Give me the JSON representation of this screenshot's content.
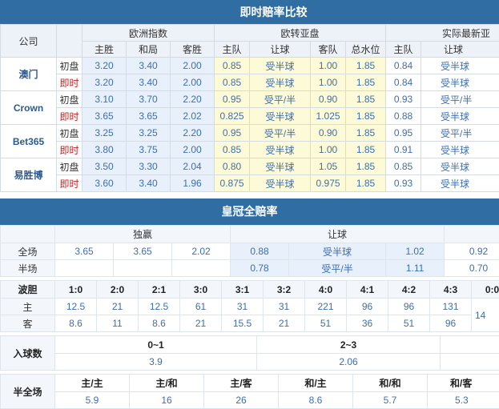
{
  "section1": {
    "title": "即时赔率比较",
    "company_header": "公司",
    "groups": [
      "欧洲指数",
      "欧转亚盘",
      "实际最新亚"
    ],
    "cols": [
      "主胜",
      "和局",
      "客胜",
      "主队",
      "让球",
      "客队",
      "总水位",
      "主队",
      "让球"
    ],
    "companies": [
      {
        "name": "澳门",
        "init": {
          "label": "初盘",
          "v": [
            "3.20",
            "3.40",
            "2.00",
            "0.85",
            "受半球",
            "1.00",
            "1.85",
            "0.84",
            "受半球"
          ]
        },
        "live": {
          "label": "即时",
          "v": [
            "3.20",
            "3.40",
            "2.00",
            "0.85",
            "受半球",
            "1.00",
            "1.85",
            "0.84",
            "受半球"
          ]
        }
      },
      {
        "name": "Crown",
        "init": {
          "label": "初盘",
          "v": [
            "3.10",
            "3.70",
            "2.20",
            "0.95",
            "受平/半",
            "0.90",
            "1.85",
            "0.93",
            "受平/半"
          ]
        },
        "live": {
          "label": "即时",
          "v": [
            "3.65",
            "3.65",
            "2.02",
            "0.825",
            "受半球",
            "1.025",
            "1.85",
            "0.88",
            "受半球"
          ]
        }
      },
      {
        "name": "Bet365",
        "init": {
          "label": "初盘",
          "v": [
            "3.25",
            "3.25",
            "2.20",
            "0.95",
            "受平/半",
            "0.90",
            "1.85",
            "0.95",
            "受平/半"
          ]
        },
        "live": {
          "label": "即时",
          "v": [
            "3.80",
            "3.75",
            "2.00",
            "0.85",
            "受半球",
            "1.00",
            "1.85",
            "0.91",
            "受半球"
          ]
        }
      },
      {
        "name": "易胜博",
        "init": {
          "label": "初盘",
          "v": [
            "3.50",
            "3.30",
            "2.04",
            "0.80",
            "受半球",
            "1.05",
            "1.85",
            "0.85",
            "受半球"
          ]
        },
        "live": {
          "label": "即时",
          "v": [
            "3.60",
            "3.40",
            "1.96",
            "0.875",
            "受半球",
            "0.975",
            "1.85",
            "0.93",
            "受半球"
          ]
        }
      }
    ]
  },
  "section2": {
    "title": "皇冠全赔率",
    "groups": [
      "独赢",
      "让球"
    ],
    "full": {
      "label": "全场",
      "v": [
        "3.65",
        "3.65",
        "2.02",
        "0.88",
        "受半球",
        "1.02",
        "0.92"
      ]
    },
    "half": {
      "label": "半场",
      "v": [
        "",
        "",
        "",
        "0.78",
        "受平/半",
        "1.11",
        "0.70"
      ]
    }
  },
  "section3": {
    "label": "波胆",
    "home_label": "主",
    "away_label": "客",
    "scores": [
      "1:0",
      "2:0",
      "2:1",
      "3:0",
      "3:1",
      "3:2",
      "4:0",
      "4:1",
      "4:2",
      "4:3",
      "0:0"
    ],
    "home": [
      "12.5",
      "21",
      "12.5",
      "61",
      "31",
      "31",
      "221",
      "96",
      "96",
      "131"
    ],
    "away": [
      "8.6",
      "11",
      "8.6",
      "21",
      "15.5",
      "21",
      "51",
      "36",
      "51",
      "96"
    ],
    "draw_value": "14"
  },
  "section4": {
    "label": "入球数",
    "ranges": [
      "0~1",
      "2~3"
    ],
    "values": [
      "3.9",
      "2.06"
    ]
  },
  "section5": {
    "label": "半全场",
    "heads": [
      "主/主",
      "主/和",
      "主/客",
      "和/主",
      "和/和",
      "和/客"
    ],
    "values": [
      "5.9",
      "16",
      "26",
      "8.6",
      "5.7",
      "5.3"
    ]
  }
}
